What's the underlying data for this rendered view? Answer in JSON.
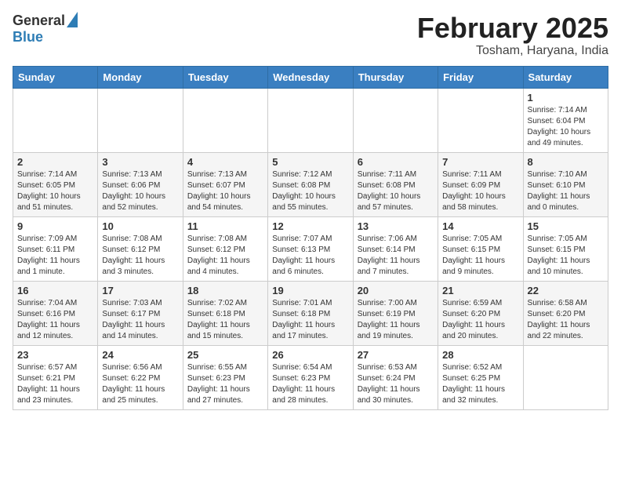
{
  "header": {
    "logo_general": "General",
    "logo_blue": "Blue",
    "main_title": "February 2025",
    "subtitle": "Tosham, Haryana, India"
  },
  "days_of_week": [
    "Sunday",
    "Monday",
    "Tuesday",
    "Wednesday",
    "Thursday",
    "Friday",
    "Saturday"
  ],
  "weeks": [
    [
      {
        "day": "",
        "info": ""
      },
      {
        "day": "",
        "info": ""
      },
      {
        "day": "",
        "info": ""
      },
      {
        "day": "",
        "info": ""
      },
      {
        "day": "",
        "info": ""
      },
      {
        "day": "",
        "info": ""
      },
      {
        "day": "1",
        "info": "Sunrise: 7:14 AM\nSunset: 6:04 PM\nDaylight: 10 hours and 49 minutes."
      }
    ],
    [
      {
        "day": "2",
        "info": "Sunrise: 7:14 AM\nSunset: 6:05 PM\nDaylight: 10 hours and 51 minutes."
      },
      {
        "day": "3",
        "info": "Sunrise: 7:13 AM\nSunset: 6:06 PM\nDaylight: 10 hours and 52 minutes."
      },
      {
        "day": "4",
        "info": "Sunrise: 7:13 AM\nSunset: 6:07 PM\nDaylight: 10 hours and 54 minutes."
      },
      {
        "day": "5",
        "info": "Sunrise: 7:12 AM\nSunset: 6:08 PM\nDaylight: 10 hours and 55 minutes."
      },
      {
        "day": "6",
        "info": "Sunrise: 7:11 AM\nSunset: 6:08 PM\nDaylight: 10 hours and 57 minutes."
      },
      {
        "day": "7",
        "info": "Sunrise: 7:11 AM\nSunset: 6:09 PM\nDaylight: 10 hours and 58 minutes."
      },
      {
        "day": "8",
        "info": "Sunrise: 7:10 AM\nSunset: 6:10 PM\nDaylight: 11 hours and 0 minutes."
      }
    ],
    [
      {
        "day": "9",
        "info": "Sunrise: 7:09 AM\nSunset: 6:11 PM\nDaylight: 11 hours and 1 minute."
      },
      {
        "day": "10",
        "info": "Sunrise: 7:08 AM\nSunset: 6:12 PM\nDaylight: 11 hours and 3 minutes."
      },
      {
        "day": "11",
        "info": "Sunrise: 7:08 AM\nSunset: 6:12 PM\nDaylight: 11 hours and 4 minutes."
      },
      {
        "day": "12",
        "info": "Sunrise: 7:07 AM\nSunset: 6:13 PM\nDaylight: 11 hours and 6 minutes."
      },
      {
        "day": "13",
        "info": "Sunrise: 7:06 AM\nSunset: 6:14 PM\nDaylight: 11 hours and 7 minutes."
      },
      {
        "day": "14",
        "info": "Sunrise: 7:05 AM\nSunset: 6:15 PM\nDaylight: 11 hours and 9 minutes."
      },
      {
        "day": "15",
        "info": "Sunrise: 7:05 AM\nSunset: 6:15 PM\nDaylight: 11 hours and 10 minutes."
      }
    ],
    [
      {
        "day": "16",
        "info": "Sunrise: 7:04 AM\nSunset: 6:16 PM\nDaylight: 11 hours and 12 minutes."
      },
      {
        "day": "17",
        "info": "Sunrise: 7:03 AM\nSunset: 6:17 PM\nDaylight: 11 hours and 14 minutes."
      },
      {
        "day": "18",
        "info": "Sunrise: 7:02 AM\nSunset: 6:18 PM\nDaylight: 11 hours and 15 minutes."
      },
      {
        "day": "19",
        "info": "Sunrise: 7:01 AM\nSunset: 6:18 PM\nDaylight: 11 hours and 17 minutes."
      },
      {
        "day": "20",
        "info": "Sunrise: 7:00 AM\nSunset: 6:19 PM\nDaylight: 11 hours and 19 minutes."
      },
      {
        "day": "21",
        "info": "Sunrise: 6:59 AM\nSunset: 6:20 PM\nDaylight: 11 hours and 20 minutes."
      },
      {
        "day": "22",
        "info": "Sunrise: 6:58 AM\nSunset: 6:20 PM\nDaylight: 11 hours and 22 minutes."
      }
    ],
    [
      {
        "day": "23",
        "info": "Sunrise: 6:57 AM\nSunset: 6:21 PM\nDaylight: 11 hours and 23 minutes."
      },
      {
        "day": "24",
        "info": "Sunrise: 6:56 AM\nSunset: 6:22 PM\nDaylight: 11 hours and 25 minutes."
      },
      {
        "day": "25",
        "info": "Sunrise: 6:55 AM\nSunset: 6:23 PM\nDaylight: 11 hours and 27 minutes."
      },
      {
        "day": "26",
        "info": "Sunrise: 6:54 AM\nSunset: 6:23 PM\nDaylight: 11 hours and 28 minutes."
      },
      {
        "day": "27",
        "info": "Sunrise: 6:53 AM\nSunset: 6:24 PM\nDaylight: 11 hours and 30 minutes."
      },
      {
        "day": "28",
        "info": "Sunrise: 6:52 AM\nSunset: 6:25 PM\nDaylight: 11 hours and 32 minutes."
      },
      {
        "day": "",
        "info": ""
      }
    ]
  ]
}
